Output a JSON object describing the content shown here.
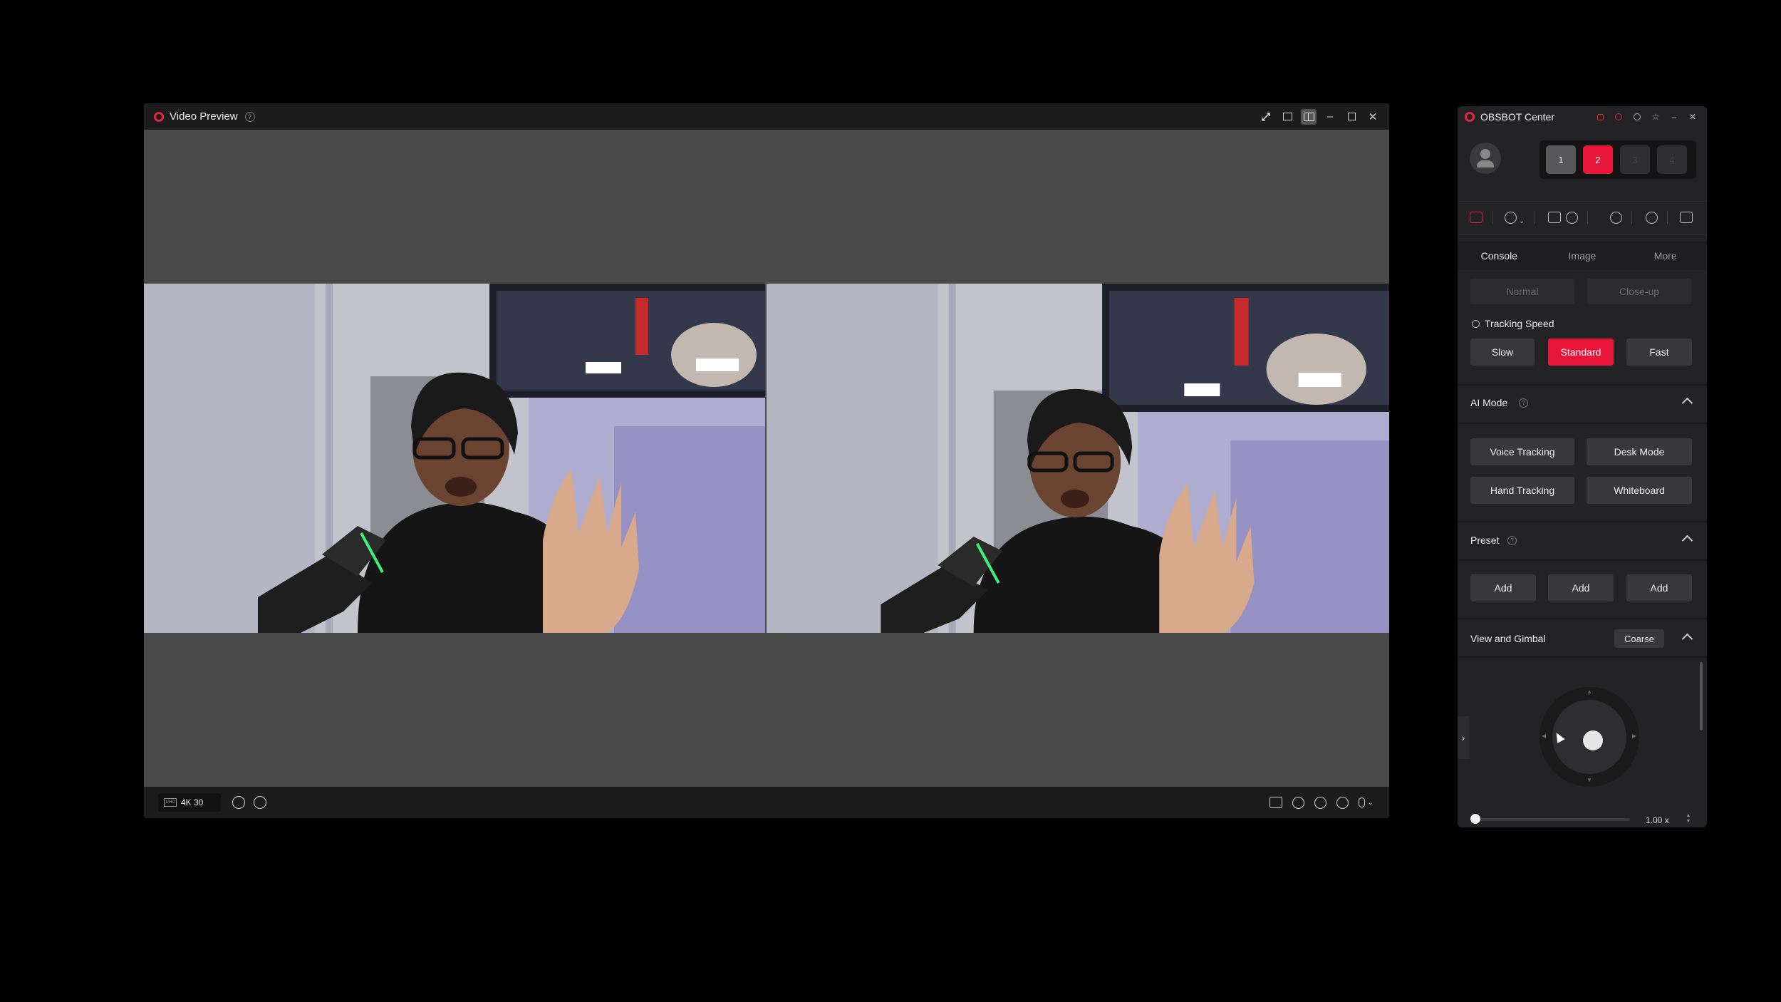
{
  "video_preview": {
    "title": "Video Preview",
    "help": "?",
    "resolution_badge": "4K 30",
    "resolution_icon": "UHD"
  },
  "obsbot": {
    "title": "OBSBOT Center",
    "devices": [
      "1",
      "2",
      "3",
      "4"
    ],
    "tabs": [
      "Console",
      "Image",
      "More"
    ],
    "framing": {
      "options": [
        "Normal",
        "Close-up"
      ]
    },
    "tracking_speed": {
      "label": "Tracking Speed",
      "options": [
        "Slow",
        "Standard",
        "Fast"
      ],
      "selected": "Standard"
    },
    "ai_mode": {
      "label": "AI Mode",
      "buttons": [
        "Voice Tracking",
        "Desk Mode",
        "Hand Tracking",
        "Whiteboard"
      ]
    },
    "preset": {
      "label": "Preset",
      "buttons": [
        "Add",
        "Add",
        "Add"
      ]
    },
    "view_gimbal": {
      "label": "View and Gimbal",
      "mode": "Coarse",
      "zoom": "1.00 x",
      "zoom_level": 0.0
    }
  },
  "colors": {
    "accent": "#e8163a",
    "panel_bg": "#232325",
    "preview_bg": "#4a4a4a"
  },
  "icons": [
    "app-logo-icon",
    "fullscreen-icon",
    "layout-single-icon",
    "layout-split-icon",
    "minimize-icon",
    "maximize-icon",
    "close-icon",
    "pin-icon",
    "settings-icon",
    "record-icon",
    "snapshot-icon",
    "power-icon",
    "camera-icon",
    "tracking-icon",
    "rotate-icon",
    "gimbal-icon",
    "microphone-icon",
    "collapse-icon"
  ]
}
